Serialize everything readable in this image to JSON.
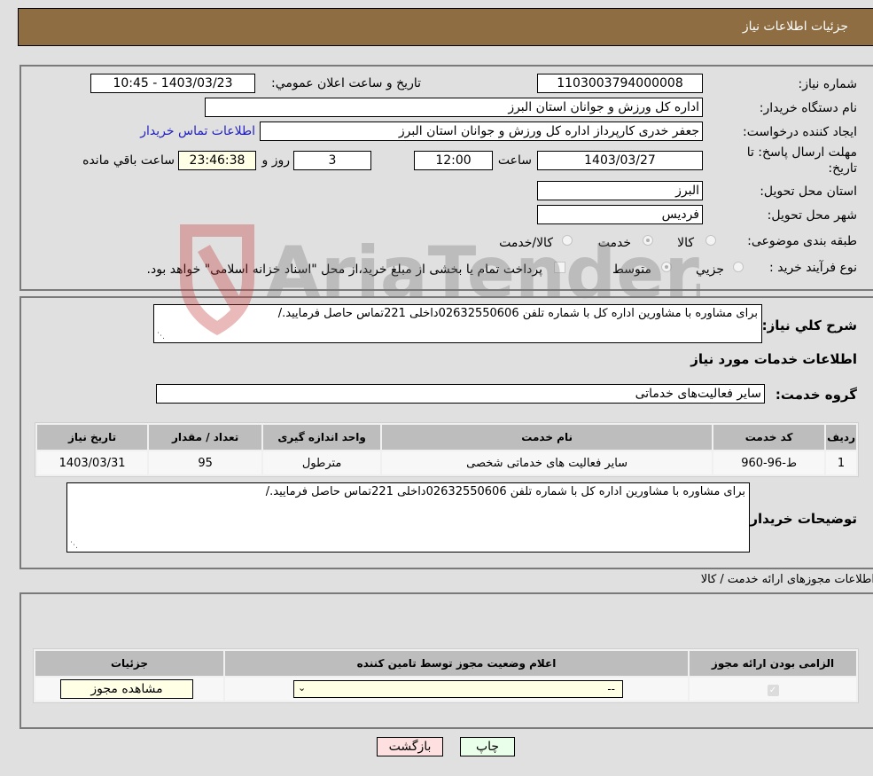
{
  "header": {
    "title": "جزئیات اطلاعات نیاز"
  },
  "info": {
    "need_number_label": "شماره نیاز:",
    "need_number": "1103003794000008",
    "announce_label": "تاریخ و ساعت اعلان عمومي:",
    "announce_value": "1403/03/23 - 10:45",
    "buyer_org_label": "نام دستگاه خریدار:",
    "buyer_org": "اداره کل ورزش و جوانان استان البرز",
    "creator_label": "ایجاد کننده درخواست:",
    "creator": "جعفر خدری کارپرداز اداره کل ورزش و جوانان استان البرز",
    "contact_link": "اطلاعات تماس خریدار",
    "deadline_label_1": "مهلت ارسال پاسخ: تا",
    "deadline_label_2": "تاریخ:",
    "deadline_date": "1403/03/27",
    "time_label": "ساعت",
    "deadline_time": "12:00",
    "days_value": "3",
    "days_label": "روز و",
    "remaining_time": "23:46:38",
    "remaining_label": "ساعت باقي مانده",
    "province_label": "استان محل تحویل:",
    "province": "البرز",
    "city_label": "شهر محل تحویل:",
    "city": "فردیس",
    "category_label": "طبقه بندی موضوعی:",
    "category_options": [
      "کالا",
      "خدمت",
      "کالا/خدمت"
    ],
    "category_selected": "خدمت",
    "process_label": "نوع فرآیند خرید :",
    "process_options": [
      "جزيي",
      "متوسط"
    ],
    "process_selected": "متوسط",
    "payment_note": "پرداخت تمام یا بخشی از مبلغ خرید،از محل \"اسناد خزانه اسلامی\" خواهد بود."
  },
  "description": {
    "label": "شرح کلي نیاز:",
    "text": "برای مشاوره با مشاورین اداره کل با شماره تلفن 02632550606داخلی 221تماس حاصل فرمایید./"
  },
  "services": {
    "section_title": "اطلاعات خدمات مورد نیاز",
    "group_label": "گروه خدمت:",
    "group_value": "سایر فعالیت‌های خدماتی",
    "table": {
      "headers": [
        "ردیف",
        "کد خدمت",
        "نام خدمت",
        "واحد اندازه گیری",
        "تعداد / مقدار",
        "تاریخ نیاز"
      ],
      "rows": [
        [
          "1",
          "ط-96-960",
          "سایر فعالیت های خدماتی شخصی",
          "مترطول",
          "95",
          "1403/03/31"
        ]
      ]
    },
    "buyer_notes_label": "توضیحات خریدار:",
    "buyer_notes": "برای مشاوره با مشاورین اداره کل با شماره تلفن 02632550606داخلی 221تماس حاصل فرمایید./"
  },
  "permits": {
    "section_title": "اطلاعات مجوزهای ارائه خدمت / کالا",
    "headers": [
      "الزامی بودن ارائه مجوز",
      "اعلام وضعیت مجوز توسط تامین کننده",
      "جزئیات"
    ],
    "row": {
      "required": true,
      "status_value": "--",
      "details_button": "مشاهده مجوز"
    }
  },
  "buttons": {
    "print": "چاپ",
    "back": "بازگشت"
  },
  "colors": {
    "header_bg": "#8e6d42",
    "print_bg": "#eaffea",
    "back_bg": "#ffe0e0",
    "link": "#2020c0"
  }
}
